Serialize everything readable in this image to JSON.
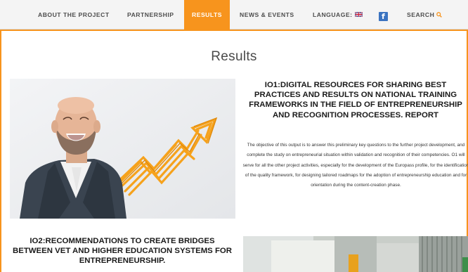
{
  "nav": {
    "items": [
      {
        "label": "ABOUT THE PROJECT"
      },
      {
        "label": "PARTNERSHIP"
      },
      {
        "label": "RESULTS"
      },
      {
        "label": "NEWS & EVENTS"
      },
      {
        "label": "LANGUAGE:"
      }
    ],
    "facebook_glyph": "f",
    "search_label": "SEARCH",
    "active_color": "#f7941d",
    "icons": [
      "uk-flag-icon",
      "facebook-icon",
      "search-icon"
    ]
  },
  "page": {
    "title": "Results"
  },
  "io1": {
    "title": "IO1:DIGITAL RESOURCES FOR SHARING BEST PRACTICES AND RESULTS ON NATIONAL TRAINING FRAMEWORKS IN THE FIELD OF ENTREPRENEURSHIP AND RECOGNITION PROCESSES. REPORT",
    "description": "The objective of this output is to answer this preliminary key questions to the further project development, and complete the study on entrepreneurial situation within validation and recognition of their competencies. O1 will serve for all the other project activities, especially for the development of the Europass profile, for the identification of the quality framework, for designing tailored roadmaps for the adoption of entrepreneurship education and for orientation during the content-creation phase."
  },
  "io2": {
    "title": "IO2:RECOMMENDATIONS TO CREATE BRIDGES BETWEEN VET AND HIGHER EDUCATION SYSTEMS FOR ENTREPRENEURSHIP."
  }
}
